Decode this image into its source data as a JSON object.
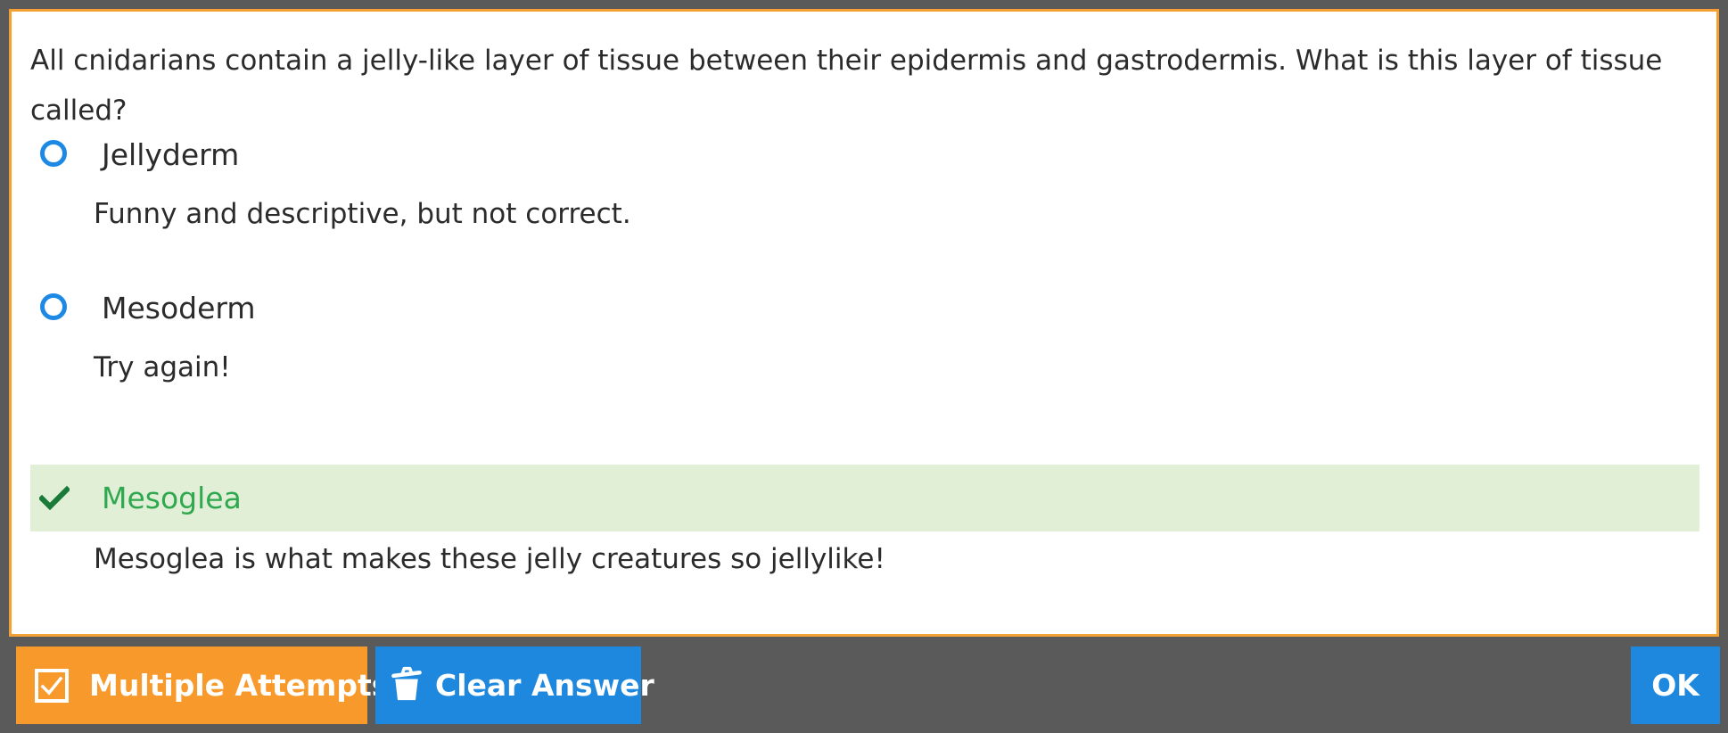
{
  "question": {
    "text": "All cnidarians contain a jelly-like layer of tissue between their epidermis and gastrodermis. What is this layer of tissue called?"
  },
  "options": [
    {
      "label": "Jellyderm",
      "feedback": "Funny and descriptive, but not correct.",
      "state": "unselected",
      "icon": "radio-icon"
    },
    {
      "label": "Mesoderm",
      "feedback": "Try again!",
      "state": "unselected",
      "icon": "radio-icon"
    },
    {
      "label": "Mesoglea",
      "feedback": "Mesoglea is what makes these jelly creatures so jellylike!",
      "state": "correct",
      "icon": "check-icon"
    }
  ],
  "toolbar": {
    "multiple_attempts_label": "Multiple Attempts",
    "multiple_attempts_icon": "checkbox-icon",
    "clear_answer_label": "Clear Answer",
    "clear_answer_icon": "trash-icon",
    "ok_label": "OK"
  },
  "colors": {
    "frame_border": "#f5a033",
    "correct_background": "#e2efd7",
    "correct_text": "#2fa84f",
    "checkmark": "#1a7a3a",
    "radio": "#1e88e5",
    "orange_button": "#f89a2b",
    "blue_button": "#1e88df",
    "background": "#5a5a5a"
  }
}
